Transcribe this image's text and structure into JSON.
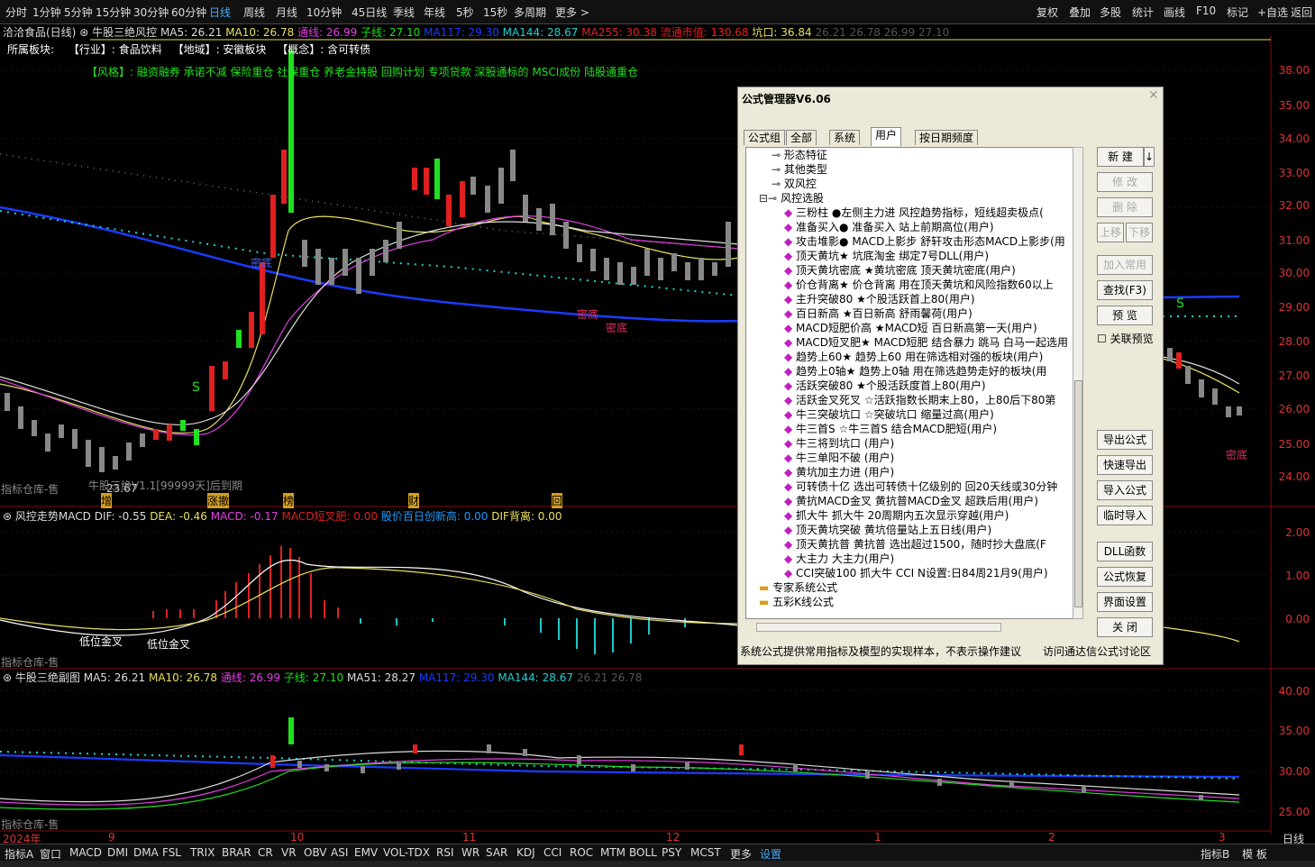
{
  "toolbar": {
    "periods": [
      "分时",
      "1分钟",
      "5分钟",
      "15分钟",
      "30分钟",
      "60分钟",
      "日线",
      "周线",
      "月线",
      "10分钟",
      "45日线",
      "季线",
      "年线",
      "5秒",
      "15秒",
      "多周期",
      "更多 >"
    ],
    "active": "日线",
    "right": [
      "复权",
      "叠加",
      "多股",
      "统计",
      "画线",
      "F10",
      "标记",
      "+自选",
      "返回"
    ]
  },
  "stock_info": {
    "title": "洽洽食品(日线)",
    "indicator": "牛股三绝风控",
    "ma5": "MA5: 26.21",
    "ma10": "MA10: 26.78",
    "tongxian": "通线: 26.99",
    "zixian": "子线: 27.10",
    "ma117": "MA117: 29.30",
    "ma144": "MA144: 28.67",
    "ma255": "MA255: 30.38",
    "liutong": "流通市值: 130.68",
    "kengkou": "坑口: 36.84",
    "extra": "26.21   26.78   26.99   27.10"
  },
  "sector_line": {
    "label": "所属板块:",
    "industry": "【行业】: 食品饮料",
    "region": "【地域】: 安徽板块",
    "concept": "【概念】: 含可转债"
  },
  "style_line": "【风格】: 融资融券 承诺不减 保险重仓 社保重仓 养老金持股 回购计划 专项贷款 深股通标的 MSCI成份 陆股通重仓",
  "main_axis": [
    "38.00",
    "35.00",
    "34.00",
    "33.00",
    "32.00",
    "31.00",
    "30.00",
    "29.00",
    "28.00",
    "27.00",
    "26.00",
    "25.00",
    "24.00"
  ],
  "main_labels": {
    "warehouse": "指标仓库-售",
    "price_low": "23.67",
    "version": "牛股三绝V1.1[99999天]后到期",
    "mi_di1": "密底",
    "mi_di2": "密底",
    "mi_di3": "密底",
    "mi_di4": "密底",
    "s1": "S",
    "s2": "S",
    "markers": [
      "增",
      "涨撤",
      "榜",
      "财",
      "回"
    ]
  },
  "macd_info": {
    "name": "风控走势MACD",
    "dif": "DIF: -0.55",
    "dea": "DEA: -0.46",
    "macd": "MACD: -0.17",
    "short": "MACD短叉肥: 0.00",
    "high": "股价百日创新高: 0.00",
    "dif_bei": "DIF背离: 0.00",
    "warehouse": "指标仓库-售",
    "golden1": "低位金叉",
    "golden2": "低位金叉"
  },
  "macd_axis": [
    "2.00",
    "1.00",
    "0.00"
  ],
  "sub_info": {
    "name": "牛股三绝副图",
    "ma5": "MA5: 26.21",
    "ma10": "MA10: 26.78",
    "tongxian": "通线: 26.99",
    "zixian": "子线: 27.10",
    "ma51": "MA51: 28.27",
    "ma117": "MA117: 29.30",
    "ma144": "MA144: 28.67",
    "extra": "26.21   26.78",
    "warehouse": "指标仓库-售"
  },
  "sub_axis": [
    "40.00",
    "35.00",
    "30.00",
    "25.00"
  ],
  "dates": [
    "2024年",
    "9",
    "10",
    "11",
    "12",
    "1",
    "2",
    "3"
  ],
  "date_right": "日线",
  "dialog": {
    "title": "公式管理器V6.06",
    "tabs": [
      "公式组",
      "全部",
      "系统",
      "用户",
      "按日期频度"
    ],
    "selected_tab": "用户",
    "tree": [
      {
        "indent": 2,
        "kind": "key",
        "text": "形态特征"
      },
      {
        "indent": 2,
        "kind": "key",
        "text": "其他类型"
      },
      {
        "indent": 2,
        "kind": "key",
        "text": "双风控"
      },
      {
        "indent": 1,
        "kind": "key-open",
        "text": "风控选股"
      },
      {
        "indent": 3,
        "kind": "f",
        "text": "三粉柱   ●左侧主力进  风控趋势指标，短线超卖极点("
      },
      {
        "indent": 3,
        "kind": "f",
        "text": "准备买入●   准备买入  站上前期高位(用户)"
      },
      {
        "indent": 3,
        "kind": "f",
        "text": "攻击堆影●   MACD上影步  舒轩攻击形态MACD上影步(用"
      },
      {
        "indent": 3,
        "kind": "f",
        "text": "顶天黄坑★   坑底淘金  绑定7号DLL(用户)"
      },
      {
        "indent": 3,
        "kind": "f",
        "text": "顶天黄坑密底   ★黄坑密底  顶天黄坑密底(用户)"
      },
      {
        "indent": 3,
        "kind": "f",
        "text": "价仓背离★   价仓背离  用在顶天黄坑和风险指数60以上"
      },
      {
        "indent": 3,
        "kind": "f",
        "text": "主升突破80   ★个股活跃首上80(用户)"
      },
      {
        "indent": 3,
        "kind": "f",
        "text": "百日新高   ★百日新高  舒雨馨荷(用户)"
      },
      {
        "indent": 3,
        "kind": "f",
        "text": "MACD短肥价高   ★MACD短  百日新高第一天(用户)"
      },
      {
        "indent": 3,
        "kind": "f",
        "text": "MACD短叉肥★   MACD短肥  结合暴力  跳马  白马一起选用"
      },
      {
        "indent": 3,
        "kind": "f",
        "text": "趋势上60★   趋势上60  用在筛选相对强的板块(用户)"
      },
      {
        "indent": 3,
        "kind": "f",
        "text": "趋势上0轴★   趋势上0轴  用在筛选趋势走好的板块(用"
      },
      {
        "indent": 3,
        "kind": "f",
        "text": "活跃突破80   ★个股活跃度首上80(用户)"
      },
      {
        "indent": 3,
        "kind": "f",
        "text": "活跃金叉死叉   ☆活跃指数长期末上80，上80后下80第"
      },
      {
        "indent": 3,
        "kind": "f",
        "text": "牛三突破坑口   ☆突破坑口  缩量过高(用户)"
      },
      {
        "indent": 3,
        "kind": "f",
        "text": "牛三首S   ☆牛三首S  结合MACD肥短(用户)"
      },
      {
        "indent": 3,
        "kind": "f",
        "text": "牛三将到坑口   (用户)"
      },
      {
        "indent": 3,
        "kind": "f",
        "text": "牛三单阳不破   (用户)"
      },
      {
        "indent": 3,
        "kind": "f",
        "text": "黄坑加主力进   (用户)"
      },
      {
        "indent": 3,
        "kind": "f",
        "text": "可转债十亿   选出可转债十亿级别的  回20天线或30分钟"
      },
      {
        "indent": 3,
        "kind": "f",
        "text": "黄抗MACD金叉   黄抗普MACD金叉   超跌后用(用户)"
      },
      {
        "indent": 3,
        "kind": "f",
        "text": "抓大牛   抓大牛  20周期内五次显示穿越(用户)"
      },
      {
        "indent": 3,
        "kind": "f",
        "text": "顶天黄坑突破   黄坑倍量站上五日线(用户)"
      },
      {
        "indent": 3,
        "kind": "f",
        "text": "顶天黄抗普   黄抗普   选出超过1500，随时抄大盘底(F"
      },
      {
        "indent": 3,
        "kind": "f",
        "text": "大主力   大主力(用户)"
      },
      {
        "indent": 3,
        "kind": "f",
        "text": "CCI突破100   抓大牛  CCI  N设置:日84周21月9(用户)"
      },
      {
        "indent": 1,
        "kind": "folder",
        "text": "专家系统公式"
      },
      {
        "indent": 1,
        "kind": "folder",
        "text": "五彩K线公式"
      }
    ],
    "buttons": [
      {
        "label": "新  建",
        "enabled": true
      },
      {
        "label": "修  改",
        "enabled": false
      },
      {
        "label": "删  除",
        "enabled": false
      },
      {
        "label": "上移",
        "enabled": false
      },
      {
        "label": "下移",
        "enabled": false
      },
      {
        "label": "加入常用",
        "enabled": false
      },
      {
        "label": "查找(F3)",
        "enabled": true
      },
      {
        "label": "预  览",
        "enabled": true
      },
      {
        "label": "关联预览",
        "enabled": true
      },
      {
        "label": "导出公式",
        "enabled": true
      },
      {
        "label": "快速导出",
        "enabled": true
      },
      {
        "label": "导入公式",
        "enabled": true
      },
      {
        "label": "临时导入",
        "enabled": true
      },
      {
        "label": "DLL函数",
        "enabled": true
      },
      {
        "label": "公式恢复",
        "enabled": true
      },
      {
        "label": "界面设置",
        "enabled": true
      },
      {
        "label": "关  闭",
        "enabled": true
      }
    ],
    "footer_left": "系统公式提供常用指标及模型的实现样本，不表示操作建议",
    "footer_right": "访问通达信公式讨论区"
  },
  "bottom_tabs": [
    "指标A",
    "窗口",
    "MACD",
    "DMI",
    "DMA",
    "FSL",
    "TRIX",
    "BRAR",
    "CR",
    "VR",
    "OBV",
    "ASI",
    "EMV",
    "VOL-TDX",
    "RSI",
    "WR",
    "SAR",
    "KDJ",
    "CCI",
    "ROC",
    "MTM",
    "BOLL",
    "PSY",
    "MCST",
    "更多",
    "设置"
  ],
  "bottom_right": [
    "指标B",
    "模 板"
  ],
  "colors": {
    "bg": "#000000",
    "up": "#ff2020",
    "down": "#00cc00",
    "ma_blue": "#1a3cff",
    "ma_white": "#dddddd",
    "ma_yellow": "#e8e060",
    "ma_magenta": "#e040e0",
    "axis": "#d03030",
    "dialog": "#ece9d8"
  }
}
